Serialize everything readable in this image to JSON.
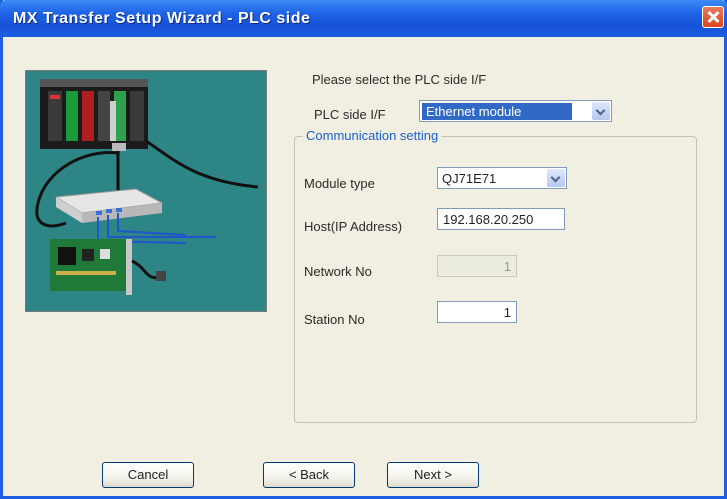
{
  "window": {
    "title": "MX Transfer Setup Wizard - PLC side"
  },
  "prompt": "Please select the PLC side I/F",
  "plc_side_if": {
    "label": "PLC side I/F",
    "value": "Ethernet module"
  },
  "communication": {
    "legend": "Communication setting",
    "module_type": {
      "label": "Module type",
      "value": "QJ71E71"
    },
    "host": {
      "label": "Host(IP Address)",
      "value": "192.168.20.250"
    },
    "network_no": {
      "label": "Network No",
      "value": "1"
    },
    "station_no": {
      "label": "Station No",
      "value": "1"
    }
  },
  "buttons": {
    "cancel": "Cancel",
    "back": "< Back",
    "next": "Next >"
  }
}
